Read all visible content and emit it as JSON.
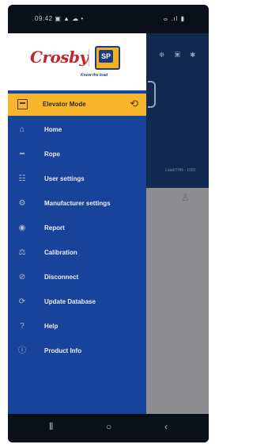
{
  "status_bar": {
    "time": "09:42 ▣ ▲ ☁ •",
    "indicators": "ⴰ .ıl ▮"
  },
  "logo": {
    "brand": "Crosby",
    "badge": "SP",
    "tagline": "Know the load"
  },
  "mode_bar": {
    "label": "Elevator Mode",
    "icon": "elevator-icon",
    "action_icon": "sync-icon"
  },
  "menu": {
    "items": [
      {
        "label": "Home",
        "icon": "home-icon"
      },
      {
        "label": "Rope",
        "icon": "rope-icon"
      },
      {
        "label": "User settings",
        "icon": "user-settings-icon"
      },
      {
        "label": "Manufacturer settings",
        "icon": "gear-icon"
      },
      {
        "label": "Report",
        "icon": "report-icon"
      },
      {
        "label": "Calibration",
        "icon": "calibration-icon"
      },
      {
        "label": "Disconnect",
        "icon": "disconnect-icon"
      },
      {
        "label": "Update Database",
        "icon": "database-icon"
      },
      {
        "label": "Help",
        "icon": "help-icon"
      },
      {
        "label": "Product Info",
        "icon": "info-icon"
      }
    ]
  },
  "background_screen": {
    "faint_text": "Load/THR - 1000"
  },
  "colors": {
    "drawer": "#17449a",
    "mode_bar": "#f7b62b",
    "brand_red": "#c3252f",
    "badge_blue": "#1c3d86"
  }
}
